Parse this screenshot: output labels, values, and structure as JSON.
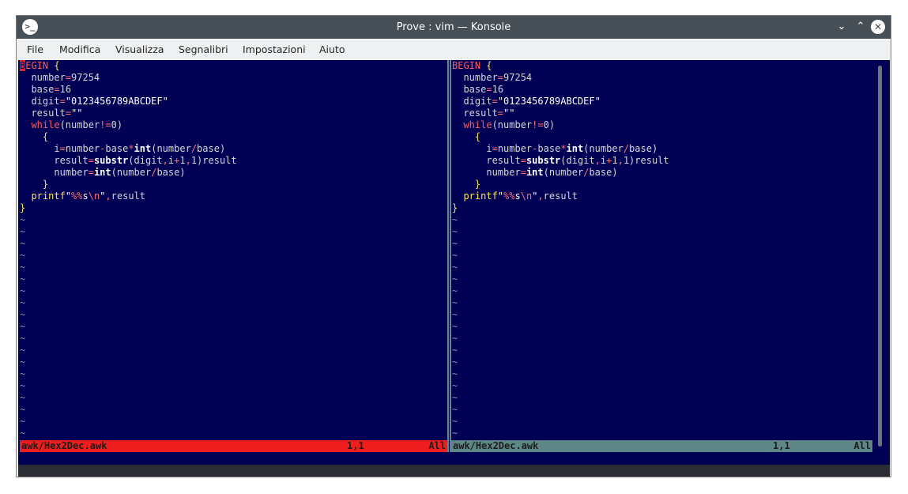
{
  "window": {
    "title": "Prove : vim — Konsole",
    "icon": "terminal-icon"
  },
  "menu": [
    "File",
    "Modifica",
    "Visualizza",
    "Segnalibri",
    "Impostazioni",
    "Aiuto"
  ],
  "editor": {
    "code": [
      "BEGIN {",
      "  number=97254",
      "  base=16",
      "  digit=\"0123456789ABCDEF\"",
      "  result=\"\"",
      "  while(number!=0)",
      "    {",
      "      i=number-base*int(number/base)",
      "      result=substr(digit,i+1,1)result",
      "      number=int(number/base)",
      "    }",
      "  printf\"%%s\\n\",result",
      "}"
    ],
    "tilde": "~",
    "tilde_rows": 20
  },
  "status": {
    "left": {
      "file": "awk/Hex2Dec.awk",
      "pos": "1,1",
      "all": "All"
    },
    "right": {
      "file": "awk/Hex2Dec.awk",
      "pos": "1,1",
      "all": "All"
    }
  },
  "colors": {
    "terminal_bg": "#000055",
    "titlebar_bg": "#475057",
    "status_active": "#ef1e1e",
    "status_inactive": "#5f8787"
  }
}
